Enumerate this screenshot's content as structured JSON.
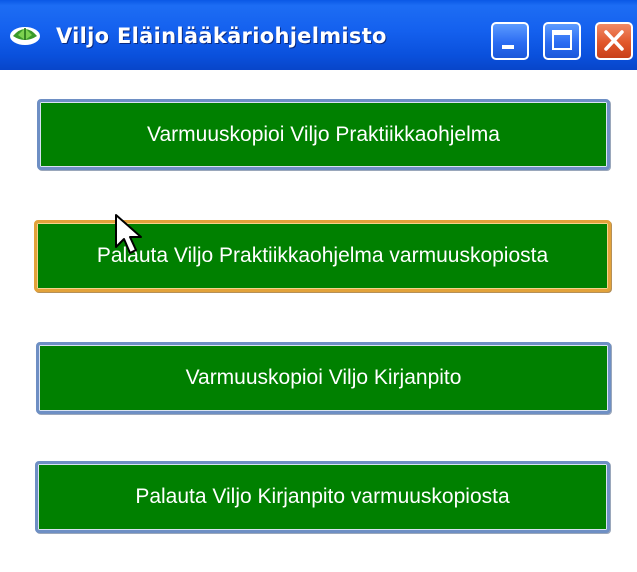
{
  "window": {
    "title": "Viljo Eläinlääkäriohjelmisto",
    "controls": [
      "minimize-icon",
      "maximize-icon",
      "close-icon"
    ]
  },
  "buttons": [
    {
      "label": "Varmuuskopioi Viljo Praktiikkaohjelma"
    },
    {
      "label": "Palauta Viljo Praktiikkaohjelma varmuuskopiosta"
    },
    {
      "label": "Varmuuskopioi Viljo Kirjanpito"
    },
    {
      "label": "Palauta Viljo Kirjanpito varmuuskopiosta"
    }
  ],
  "colors": {
    "titlebar": "#0a58e6",
    "button_fill": "#008000",
    "button_border": "#6e8fc4",
    "focused_border": "#e2a23a",
    "close_button": "#e1572b"
  }
}
